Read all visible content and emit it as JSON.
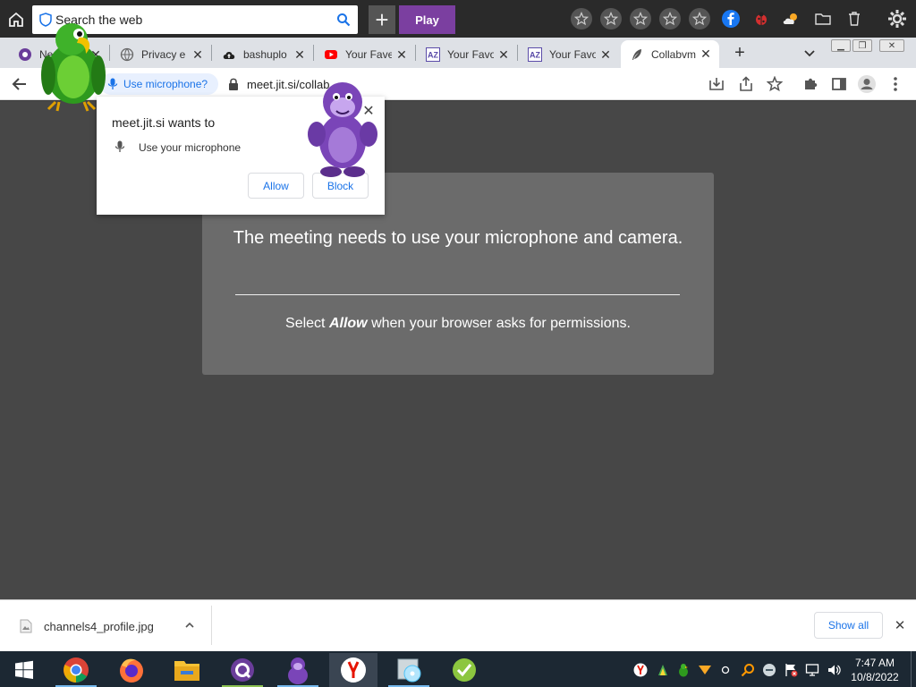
{
  "toolbar": {
    "search_placeholder": "Search the web",
    "play_label": "Play"
  },
  "tabs": [
    {
      "title": "Ne",
      "favicon": "circle-icon"
    },
    {
      "title": "Privacy e",
      "favicon": "globe-icon"
    },
    {
      "title": "bashuplo",
      "favicon": "cloud-upload-icon"
    },
    {
      "title": "Your Fave",
      "favicon": "youtube-icon"
    },
    {
      "title": "Your Favo",
      "favicon": "az-icon"
    },
    {
      "title": "Your Favo",
      "favicon": "az-icon"
    },
    {
      "title": "Collabvm",
      "favicon": "feather-icon"
    }
  ],
  "address": {
    "mic_chip": "Use microphone?",
    "url": "meet.jit.si/collab"
  },
  "popup": {
    "title": "meet.jit.si wants to",
    "permission": "Use your microphone",
    "allow": "Allow",
    "block": "Block"
  },
  "page": {
    "title": "The meeting needs to use your microphone and camera.",
    "sub_prefix": "Select ",
    "sub_bold": "Allow",
    "sub_suffix": " when your browser asks for permissions."
  },
  "download": {
    "filename": "channels4_profile.jpg",
    "show_all": "Show all"
  },
  "clock": {
    "time": "7:47 AM",
    "date": "10/8/2022"
  },
  "colors": {
    "accent": "#1a73e8",
    "play": "#7b3fa0",
    "card": "#6b6b6b",
    "page": "#474747"
  }
}
